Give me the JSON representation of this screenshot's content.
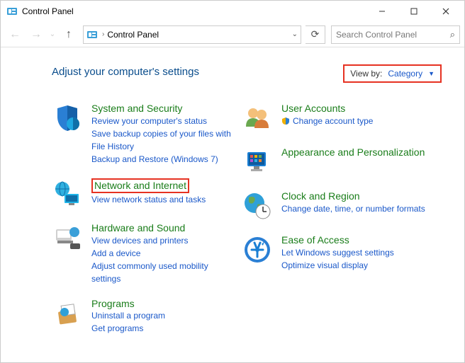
{
  "window": {
    "title": "Control Panel",
    "address": "Control Panel",
    "search_placeholder": "Search Control Panel"
  },
  "heading": "Adjust your computer's settings",
  "viewby": {
    "label": "View by:",
    "value": "Category"
  },
  "left_column": [
    {
      "title": "System and Security",
      "subs": [
        "Review your computer's status",
        "Save backup copies of your files with File History",
        "Backup and Restore (Windows 7)"
      ]
    },
    {
      "title": "Network and Internet",
      "highlight": true,
      "subs": [
        "View network status and tasks"
      ]
    },
    {
      "title": "Hardware and Sound",
      "subs": [
        "View devices and printers",
        "Add a device",
        "Adjust commonly used mobility settings"
      ]
    },
    {
      "title": "Programs",
      "subs": [
        "Uninstall a program",
        "Get programs"
      ]
    }
  ],
  "right_column": [
    {
      "title": "User Accounts",
      "subs_with_icon": [
        {
          "icon": "shield",
          "label": "Change account type"
        }
      ]
    },
    {
      "title": "Appearance and Personalization",
      "subs": []
    },
    {
      "title": "Clock and Region",
      "subs": [
        "Change date, time, or number formats"
      ]
    },
    {
      "title": "Ease of Access",
      "subs": [
        "Let Windows suggest settings",
        "Optimize visual display"
      ]
    }
  ]
}
